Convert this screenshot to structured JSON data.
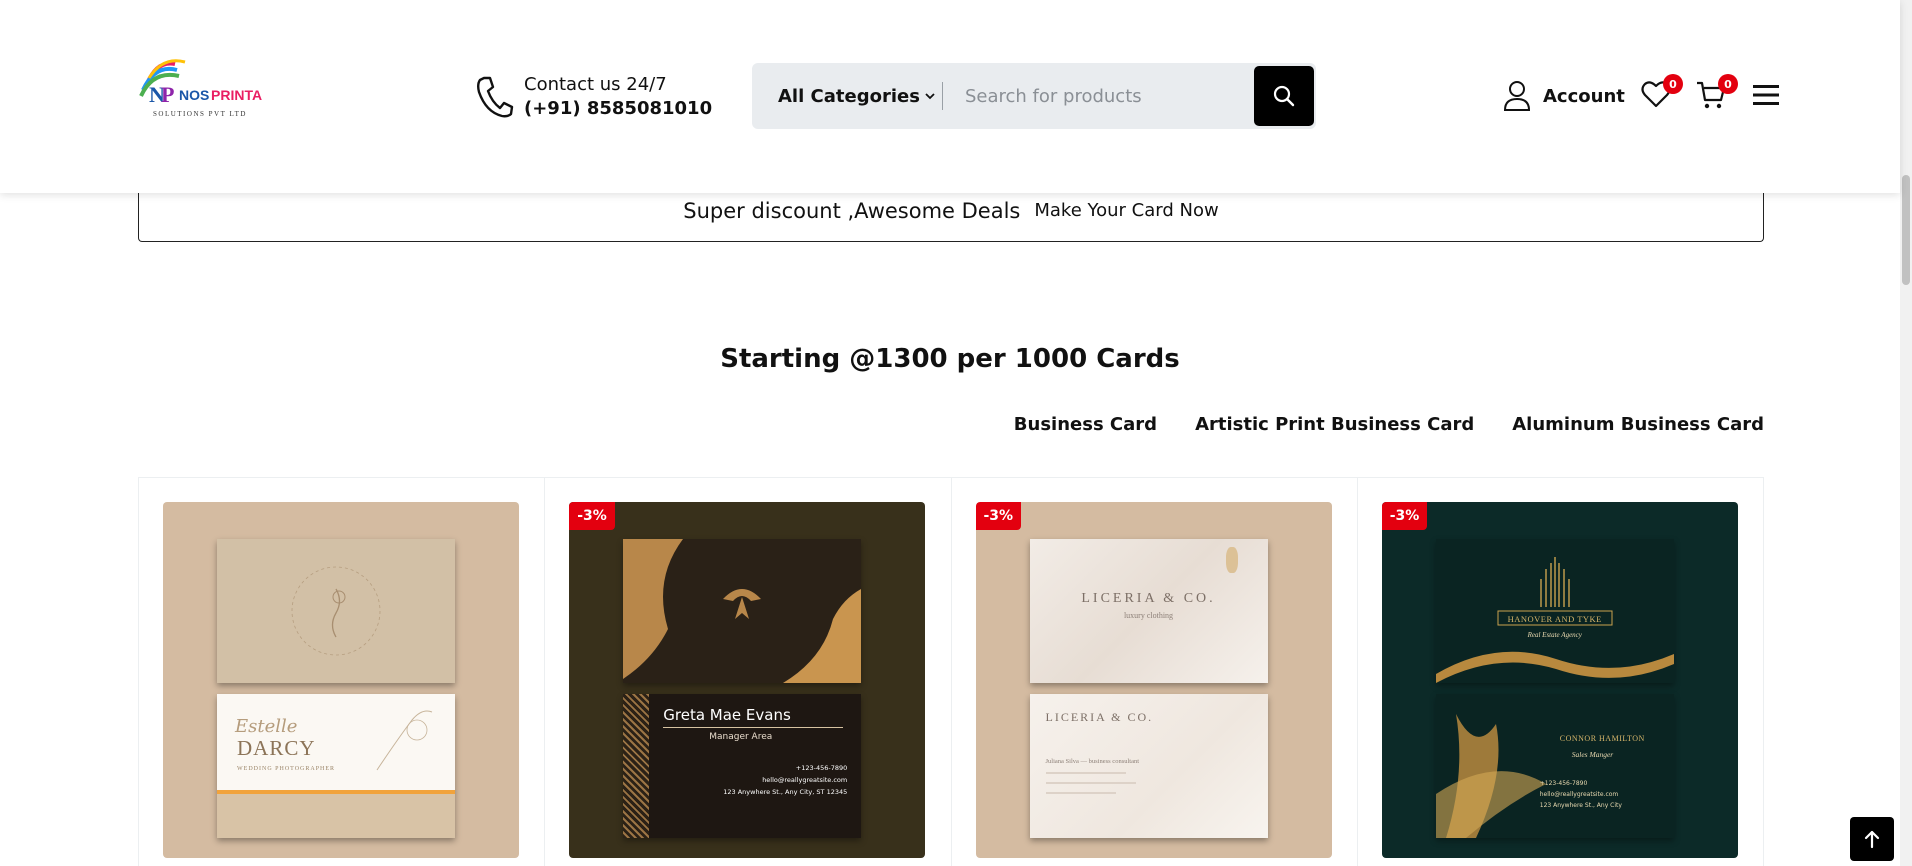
{
  "header": {
    "brand_text": "NOSPRINTA",
    "brand_sub": "SOLUTIONS PVT LTD",
    "contact_line1": "Contact us 24/7",
    "contact_line2": "(+91) 8585081010",
    "category_label": "All Categories",
    "search_placeholder": "Search for products",
    "account_label": "Account",
    "wishlist_count": "0",
    "cart_count": "0"
  },
  "promo": {
    "text": "Super discount ,Awesome Deals",
    "cta": "Make Your Card Now"
  },
  "section": {
    "heading": "Starting @1300 per 1000 Cards",
    "tabs": [
      "Business Card",
      "Artistic Print Business Card",
      "Aluminum Business Card"
    ]
  },
  "products": [
    {
      "discount": "",
      "bg": "#d4bba1",
      "card_lines": [
        "Estelle",
        "DARCY",
        "WEDDING PHOTOGRAPHER"
      ]
    },
    {
      "discount": "-3%",
      "bg": "#38301b",
      "card_lines": [
        "Greta Mae Evans",
        "Manager Area",
        "+123-456-7890",
        "hello@reallygreatsite.com",
        "123 Anywhere St., Any City, ST 12345"
      ]
    },
    {
      "discount": "-3%",
      "bg": "#d4bba1",
      "card_lines": [
        "LICERIA & CO.",
        "luxury clothing",
        "LICERIA & CO.",
        "Juliana Silva — business consultant"
      ]
    },
    {
      "discount": "-3%",
      "bg": "#0c2a28",
      "card_lines": [
        "HANOVER AND TYKE",
        "Real Estate Agency",
        "CONNOR HAMILTON",
        "Sales Manger",
        "+123-456-7890",
        "hello@reallygreatsite.com",
        "123 Anywhere St., Any City"
      ]
    }
  ],
  "colors": {
    "accent_badge": "#e3000f",
    "search_bg": "#e9ecef",
    "button_dark": "#000000"
  },
  "icons": [
    "phone-icon",
    "chevron-down-icon",
    "search-icon",
    "user-icon",
    "heart-icon",
    "cart-icon",
    "menu-icon",
    "arrow-up-icon"
  ]
}
